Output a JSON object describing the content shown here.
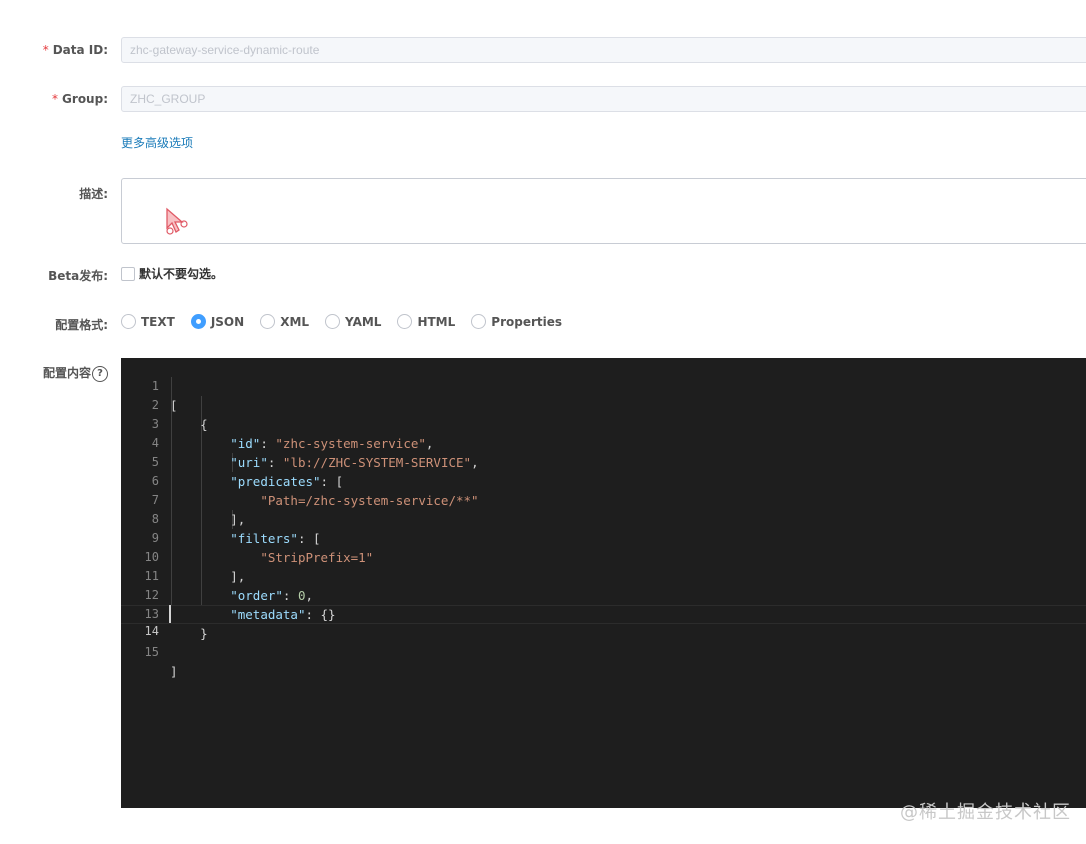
{
  "form": {
    "data_id": {
      "label": "Data ID:",
      "required": "*",
      "value": "zhc-gateway-service-dynamic-route"
    },
    "group": {
      "label": "Group:",
      "required": "*",
      "value": "ZHC_GROUP"
    },
    "more_options_link": "更多高级选项",
    "description": {
      "label": "描述:",
      "value": ""
    },
    "beta": {
      "label": "Beta发布:",
      "checkbox_text": "默认不要勾选。",
      "checked": false
    },
    "format": {
      "label": "配置格式:",
      "options": [
        "TEXT",
        "JSON",
        "XML",
        "YAML",
        "HTML",
        "Properties"
      ],
      "selected": "JSON"
    },
    "content": {
      "label": "配置内容",
      "help_icon": "?"
    }
  },
  "editor": {
    "line_numbers": [
      "1",
      "2",
      "3",
      "4",
      "5",
      "6",
      "7",
      "8",
      "9",
      "10",
      "11",
      "12",
      "13",
      "14",
      "15"
    ],
    "active_line": "14",
    "tokens": {
      "l1": "[",
      "l2": "{",
      "l3_key": "\"id\"",
      "l3_sep": ": ",
      "l3_val": "\"zhc-system-service\"",
      "l3_end": ",",
      "l4_key": "\"uri\"",
      "l4_sep": ": ",
      "l4_val": "\"lb://ZHC-SYSTEM-SERVICE\"",
      "l4_end": ",",
      "l5_key": "\"predicates\"",
      "l5_sep": ": [",
      "l6_val": "\"Path=/zhc-system-service/**\"",
      "l7": "],",
      "l8_key": "\"filters\"",
      "l8_sep": ": [",
      "l9_val": "\"StripPrefix=1\"",
      "l10": "],",
      "l11_key": "\"order\"",
      "l11_sep": ": ",
      "l11_val": "0",
      "l11_end": ",",
      "l12_key": "\"metadata\"",
      "l12_sep": ": {}",
      "l13": "}",
      "l14": "",
      "l15": "]"
    }
  },
  "watermark": "@稀土掘金技术社区",
  "colors": {
    "required": "#e4393c",
    "link": "#1a7bb9",
    "radio_selected": "#409eff",
    "editor_bg": "#1e1e1e",
    "json_key": "#9cdcfe",
    "json_string": "#ce9178",
    "json_number": "#b5cea8"
  }
}
